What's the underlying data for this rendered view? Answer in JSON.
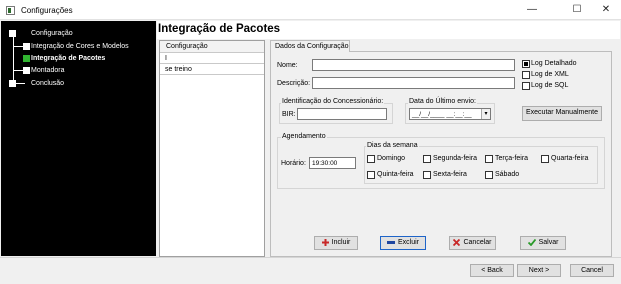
{
  "window": {
    "title": "Configurações",
    "minimize": "—",
    "maximize": "☐",
    "close": "✕"
  },
  "steps": [
    {
      "label": "Configuração",
      "active": false
    },
    {
      "label": "Integração de Cores e Modelos",
      "active": false
    },
    {
      "label": "Integração de Pacotes",
      "active": true
    },
    {
      "label": "Montadora",
      "active": false
    },
    {
      "label": "Conclusão",
      "active": false
    }
  ],
  "header": {
    "title": "Integração de Pacotes"
  },
  "list": {
    "column": "Configuração",
    "rows": [
      "I",
      "se treino"
    ]
  },
  "form": {
    "tab": "Dados da Configuração",
    "nome_label": "Nome:",
    "nome_value": "",
    "descricao_label": "Descrição:",
    "descricao_value": "",
    "checks": [
      {
        "label": "Log Detalhado",
        "checked": true
      },
      {
        "label": "Log de XML",
        "checked": false
      },
      {
        "label": "Log de SQL",
        "checked": false
      }
    ],
    "concessionario_label": "Identificação do Concessionário:",
    "bir_label": "BIR:",
    "bir_value": "",
    "ultimo_envio_label": "Data do Último envio:",
    "ultimo_envio_value": "__/__/____ __:__:__",
    "executar_button": "Executar Manualmente",
    "agendamento_label": "Agendamento",
    "horario_label": "Horário:",
    "horario_value": "19:30:00",
    "dias_label": "Dias da semana",
    "dias": [
      {
        "label": "Domingo",
        "checked": false
      },
      {
        "label": "Segunda-feira",
        "checked": false
      },
      {
        "label": "Terça-feira",
        "checked": false
      },
      {
        "label": "Quarta-feira",
        "checked": false
      },
      {
        "label": "Quinta-feira",
        "checked": false
      },
      {
        "label": "Sexta-feira",
        "checked": false
      },
      {
        "label": "Sábado",
        "checked": false
      }
    ],
    "buttons": {
      "incluir": "Incluir",
      "excluir": "Excluir",
      "cancelar": "Cancelar",
      "salvar": "Salvar"
    }
  },
  "nav": {
    "back": "< Back",
    "next": "Next >",
    "cancel": "Cancel"
  },
  "colors": {
    "active_step": "#31b531",
    "panel_bg": "#000000",
    "focus_border": "#1e64c8"
  }
}
